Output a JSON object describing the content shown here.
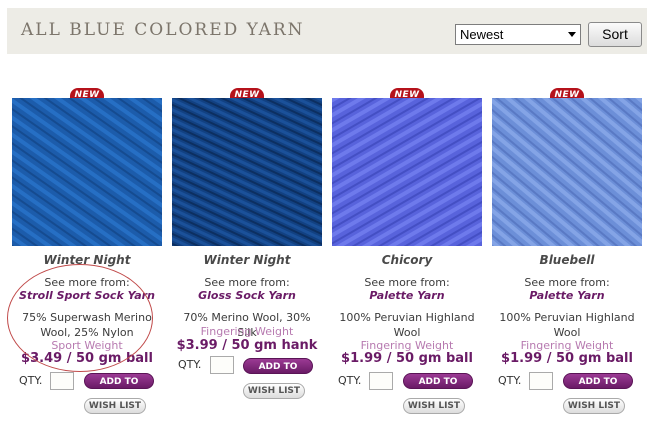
{
  "header": {
    "title": "ALL BLUE COLORED YARN",
    "sort_selected": "Newest",
    "sort_button": "Sort"
  },
  "products": [
    {
      "badge": "NEW",
      "name": "Winter Night",
      "see_more": "See more from:",
      "line": "Stroll Sport Sock Yarn",
      "fiber": "75% Superwash Merino Wool, 25% Nylon",
      "weight": "Sport Weight",
      "price": "$3.49 / 50 gm ball",
      "qty_label": "QTY.",
      "add_to_cart": "ADD TO CART",
      "wish_list": "WISH LIST",
      "color": "#1f62b3"
    },
    {
      "badge": "NEW",
      "name": "Winter Night",
      "see_more": "See more from:",
      "line": "Gloss Sock Yarn",
      "fiber": "70% Merino Wool, 30% Silk",
      "weight": "Fingering Weight",
      "price": "$3.99 / 50 gm hank",
      "qty_label": "QTY.",
      "add_to_cart": "ADD TO CART",
      "wish_list": "WISH LIST",
      "color": "#14478c"
    },
    {
      "badge": "NEW",
      "name": "Chicory",
      "see_more": "See more from:",
      "line": "Palette Yarn",
      "fiber": "100% Peruvian Highland Wool",
      "weight": "Fingering Weight",
      "price": "$1.99 / 50 gm ball",
      "qty_label": "QTY.",
      "add_to_cart": "ADD TO CART",
      "wish_list": "WISH LIST",
      "color": "#5863dc"
    },
    {
      "badge": "NEW",
      "name": "Bluebell",
      "see_more": "See more from:",
      "line": "Palette Yarn",
      "fiber": "100% Peruvian Highland Wool",
      "weight": "Fingering Weight",
      "price": "$1.99 / 50 gm ball",
      "qty_label": "QTY.",
      "add_to_cart": "ADD TO CART",
      "wish_list": "WISH LIST",
      "color": "#6c8fd8"
    }
  ]
}
